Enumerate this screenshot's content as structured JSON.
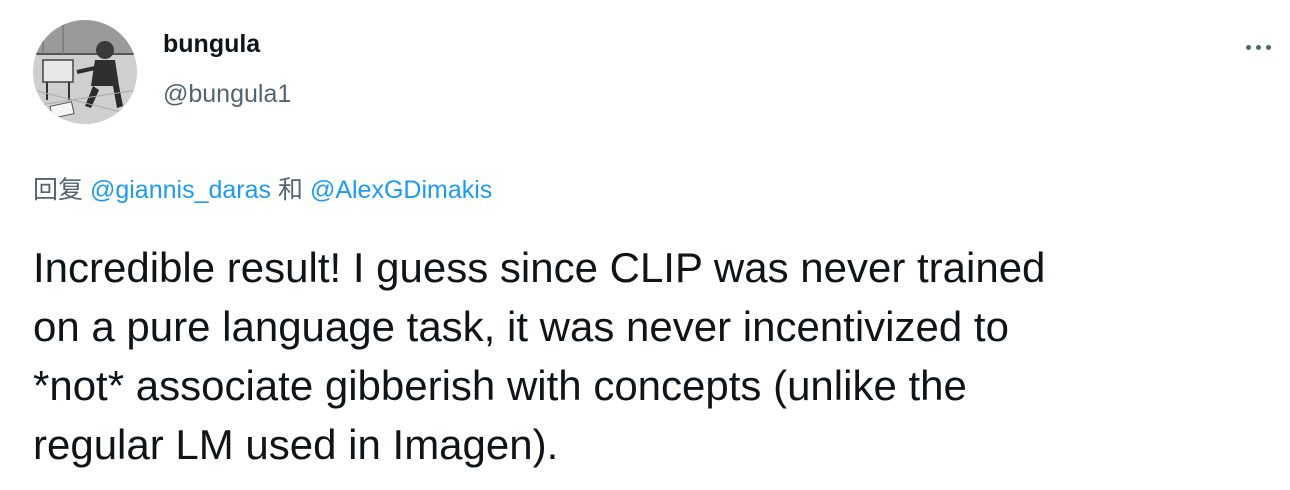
{
  "author": {
    "display_name": "bungula",
    "handle": "@bungula1",
    "avatar_icon": "avatar-sketch-icon"
  },
  "more_icon": "more-horizontal-icon",
  "reply": {
    "prefix": "回复",
    "mention_1": "@giannis_daras",
    "conjunction": "和",
    "mention_2": "@AlexGDimakis"
  },
  "tweet": {
    "text": "Incredible result! I guess since CLIP was never trained\non a pure language task, it was never incentivized to\n*not* associate gibberish with concepts (unlike the\nregular LM used in Imagen)."
  },
  "colors": {
    "text_primary": "#0f1419",
    "text_secondary": "#536471",
    "link": "#1d9bf0",
    "background": "#ffffff"
  }
}
